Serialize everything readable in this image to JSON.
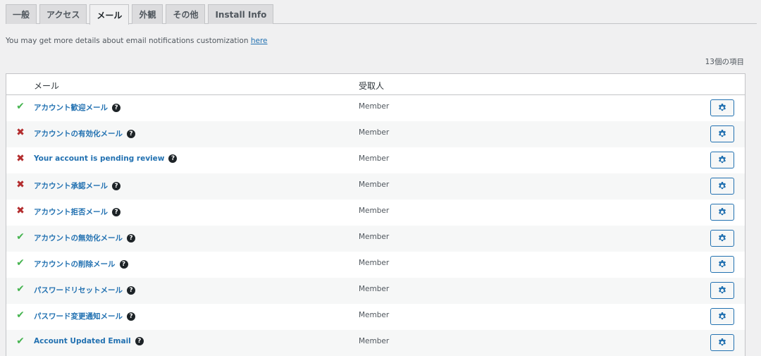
{
  "tabs": [
    {
      "label": "一般",
      "active": false
    },
    {
      "label": "アクセス",
      "active": false
    },
    {
      "label": "メール",
      "active": true
    },
    {
      "label": "外観",
      "active": false
    },
    {
      "label": "その他",
      "active": false
    },
    {
      "label": "Install Info",
      "active": false
    }
  ],
  "info": {
    "text": "You may get more details about email notifications customization ",
    "link": "here"
  },
  "items_count": "13個の項目",
  "table": {
    "headers": {
      "email": "メール",
      "recipient": "受取人"
    },
    "rows": [
      {
        "enabled": true,
        "name": "アカウント歓迎メール",
        "recipient": "Member"
      },
      {
        "enabled": false,
        "name": "アカウントの有効化メール",
        "recipient": "Member"
      },
      {
        "enabled": false,
        "name": "Your account is pending review",
        "recipient": "Member"
      },
      {
        "enabled": false,
        "name": "アカウント承認メール",
        "recipient": "Member"
      },
      {
        "enabled": false,
        "name": "アカウント拒否メール",
        "recipient": "Member"
      },
      {
        "enabled": true,
        "name": "アカウントの無効化メール",
        "recipient": "Member"
      },
      {
        "enabled": true,
        "name": "アカウントの削除メール",
        "recipient": "Member"
      },
      {
        "enabled": true,
        "name": "パスワードリセットメール",
        "recipient": "Member"
      },
      {
        "enabled": true,
        "name": "パスワード変更通知メール",
        "recipient": "Member"
      },
      {
        "enabled": true,
        "name": "Account Updated Email",
        "recipient": "Member"
      }
    ]
  },
  "icons": {
    "enabled": "checkmark-icon",
    "disabled": "cross-icon",
    "help": "help-icon",
    "settings": "gear-icon"
  },
  "colors": {
    "link": "#2271b1",
    "enabled": "#46b450",
    "disabled": "#b32d2e"
  }
}
